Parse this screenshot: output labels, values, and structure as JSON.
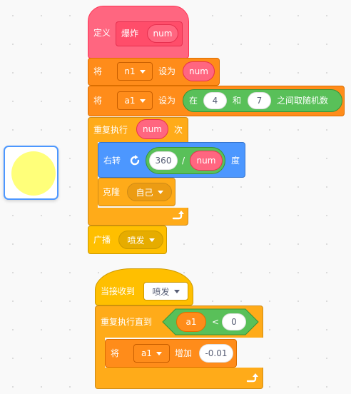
{
  "sprite_preview": {
    "color": "#ffff7a"
  },
  "define_block": {
    "label": "定义",
    "name": "爆炸",
    "param": "num"
  },
  "set_n1": {
    "prefix": "将",
    "variable": "n1",
    "mid": "设为",
    "value": "num"
  },
  "set_a1": {
    "prefix": "将",
    "variable": "a1",
    "mid": "设为",
    "random_prefix": "在",
    "from": "4",
    "and": "和",
    "to": "7",
    "random_suffix": "之间取随机数"
  },
  "repeat_block": {
    "label": "重复执行",
    "count": "num",
    "suffix": "次"
  },
  "turn_block": {
    "label": "右转",
    "dividend": "360",
    "operator": "/",
    "divisor": "num",
    "suffix": "度"
  },
  "clone_block": {
    "label": "克隆",
    "target": "自己"
  },
  "broadcast_block": {
    "label": "广播",
    "message": "喷发"
  },
  "when_receive": {
    "label": "当接收到",
    "message": "喷发"
  },
  "repeat_until": {
    "label": "重复执行直到",
    "left": "a1",
    "operator": "<",
    "right": "0"
  },
  "change_a1": {
    "prefix": "将",
    "variable": "a1",
    "mid": "增加",
    "value": "-0.01"
  },
  "colors": {
    "control": "#ffab19",
    "variables": "#ff8c1a",
    "custom": "#ff6680",
    "operators": "#59c059",
    "motion": "#4c97ff",
    "events": "#ffbf00"
  },
  "icons": {
    "loop_arrow": "loop-arrow-icon",
    "turn_right": "rotate-right-icon"
  }
}
